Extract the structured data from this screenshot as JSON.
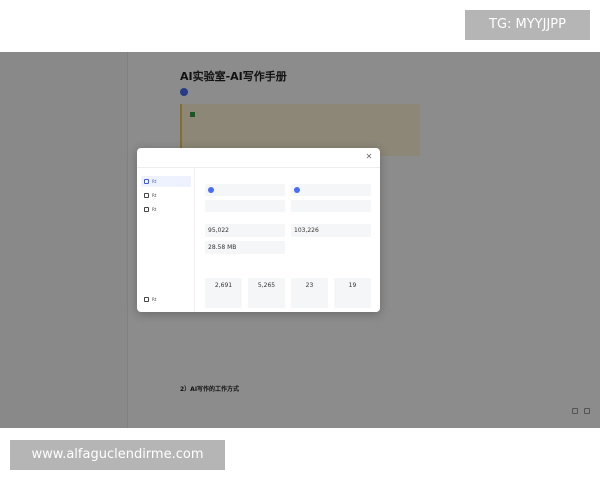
{
  "watermarks": {
    "top": "TG: MYYJJPP",
    "bottom": "www.alfaguclendirme.com"
  },
  "document": {
    "title": "AI实验室-AI写作手册",
    "sections": [
      {
        "heading": "2）AI写作的工作方式"
      }
    ]
  },
  "dialog": {
    "nav": [
      {
        "label": "Rt",
        "icon": "info-icon",
        "active": true
      },
      {
        "label": "Rt",
        "icon": "history-icon",
        "active": false
      },
      {
        "label": "Rt",
        "icon": "edit-icon",
        "active": false
      },
      {
        "label": "Rt",
        "icon": "settings-icon",
        "active": false
      }
    ],
    "stats": {
      "count_1": "95,022",
      "count_2": "103,226",
      "size": "28.58 MB"
    },
    "cards": [
      {
        "value": "2,691"
      },
      {
        "value": "5,265"
      },
      {
        "value": "23"
      },
      {
        "value": "19"
      }
    ]
  },
  "colors": {
    "accent": "#3b5bd9",
    "positive": "#2ea043",
    "callout_bg": "#fff6d9",
    "overlay": "rgba(0,0,0,0.45)"
  }
}
